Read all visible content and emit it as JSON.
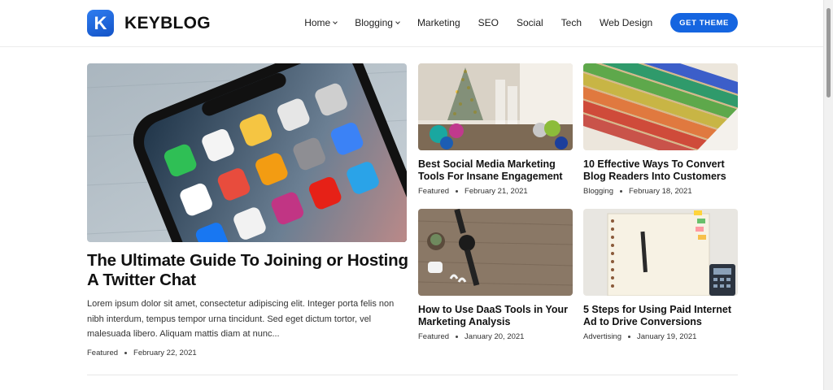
{
  "brand": {
    "logo_letter": "K",
    "name": "KEYBLOG"
  },
  "nav": {
    "items": [
      {
        "label": "Home",
        "dropdown": true
      },
      {
        "label": "Blogging",
        "dropdown": true
      },
      {
        "label": "Marketing",
        "dropdown": false
      },
      {
        "label": "SEO",
        "dropdown": false
      },
      {
        "label": "Social",
        "dropdown": false
      },
      {
        "label": "Tech",
        "dropdown": false
      },
      {
        "label": "Web Design",
        "dropdown": false
      }
    ],
    "cta_label": "GET THEME"
  },
  "featured": {
    "title": "The Ultimate Guide To Joining or Hosting A Twitter Chat",
    "excerpt": "Lorem ipsum dolor sit amet, consectetur adipiscing elit. Integer porta felis non nibh interdum, tempus tempor urna tincidunt. Sed eget dictum tortor, vel malesuada libero. Aliquam mattis diam at nunc...",
    "category": "Featured",
    "date": "February 22, 2021"
  },
  "posts": [
    {
      "title": "Best Social Media Marketing Tools For Insane Engagement",
      "category": "Featured",
      "date": "February 21, 2021"
    },
    {
      "title": "10 Effective Ways To Convert Blog Readers Into Customers",
      "category": "Blogging",
      "date": "February 18, 2021"
    },
    {
      "title": "How to Use DaaS Tools in Your Marketing Analysis",
      "category": "Featured",
      "date": "January 20, 2021"
    },
    {
      "title": "5 Steps for Using Paid Internet Ad to Drive Conversions",
      "category": "Advertising",
      "date": "January 19, 2021"
    }
  ],
  "colors": {
    "accent": "#1565e0",
    "text": "#111111"
  }
}
